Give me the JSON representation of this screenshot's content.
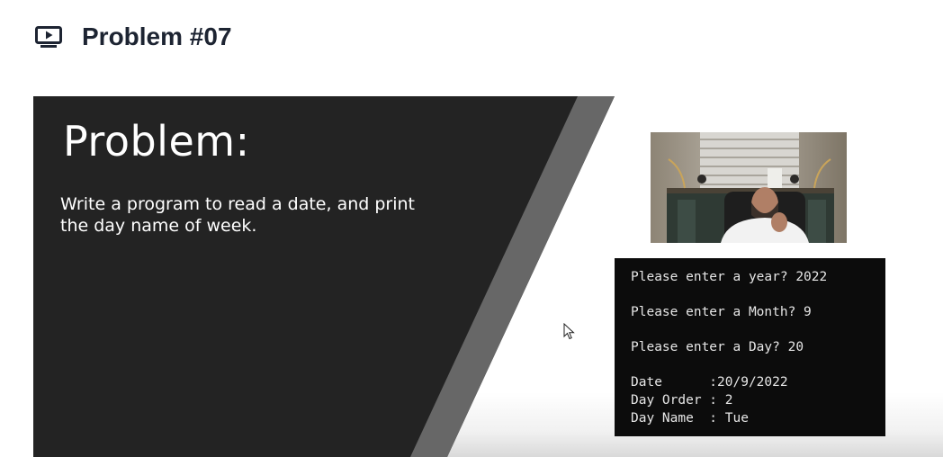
{
  "header": {
    "icon": "video-play-icon",
    "title": "Problem #07"
  },
  "slide": {
    "heading": "Problem:",
    "body": "Write a program to read a date, and print the day name of week."
  },
  "console": {
    "lines": [
      "Please enter a year? 2022",
      "Please enter a Month? 9",
      "Please enter a Day? 20",
      "Date      :20/9/2022",
      "Day Order : 2",
      "Day Name  : Tue"
    ]
  },
  "webcam": {
    "icon": "presenter-webcam"
  },
  "cursor": {
    "icon": "mouse-pointer-icon"
  },
  "colors": {
    "title_text": "#1d2432",
    "slide_dark": "#232323",
    "slide_stripe": "#676767",
    "console_bg": "#0c0c0c",
    "console_text": "#e6e6e6"
  }
}
